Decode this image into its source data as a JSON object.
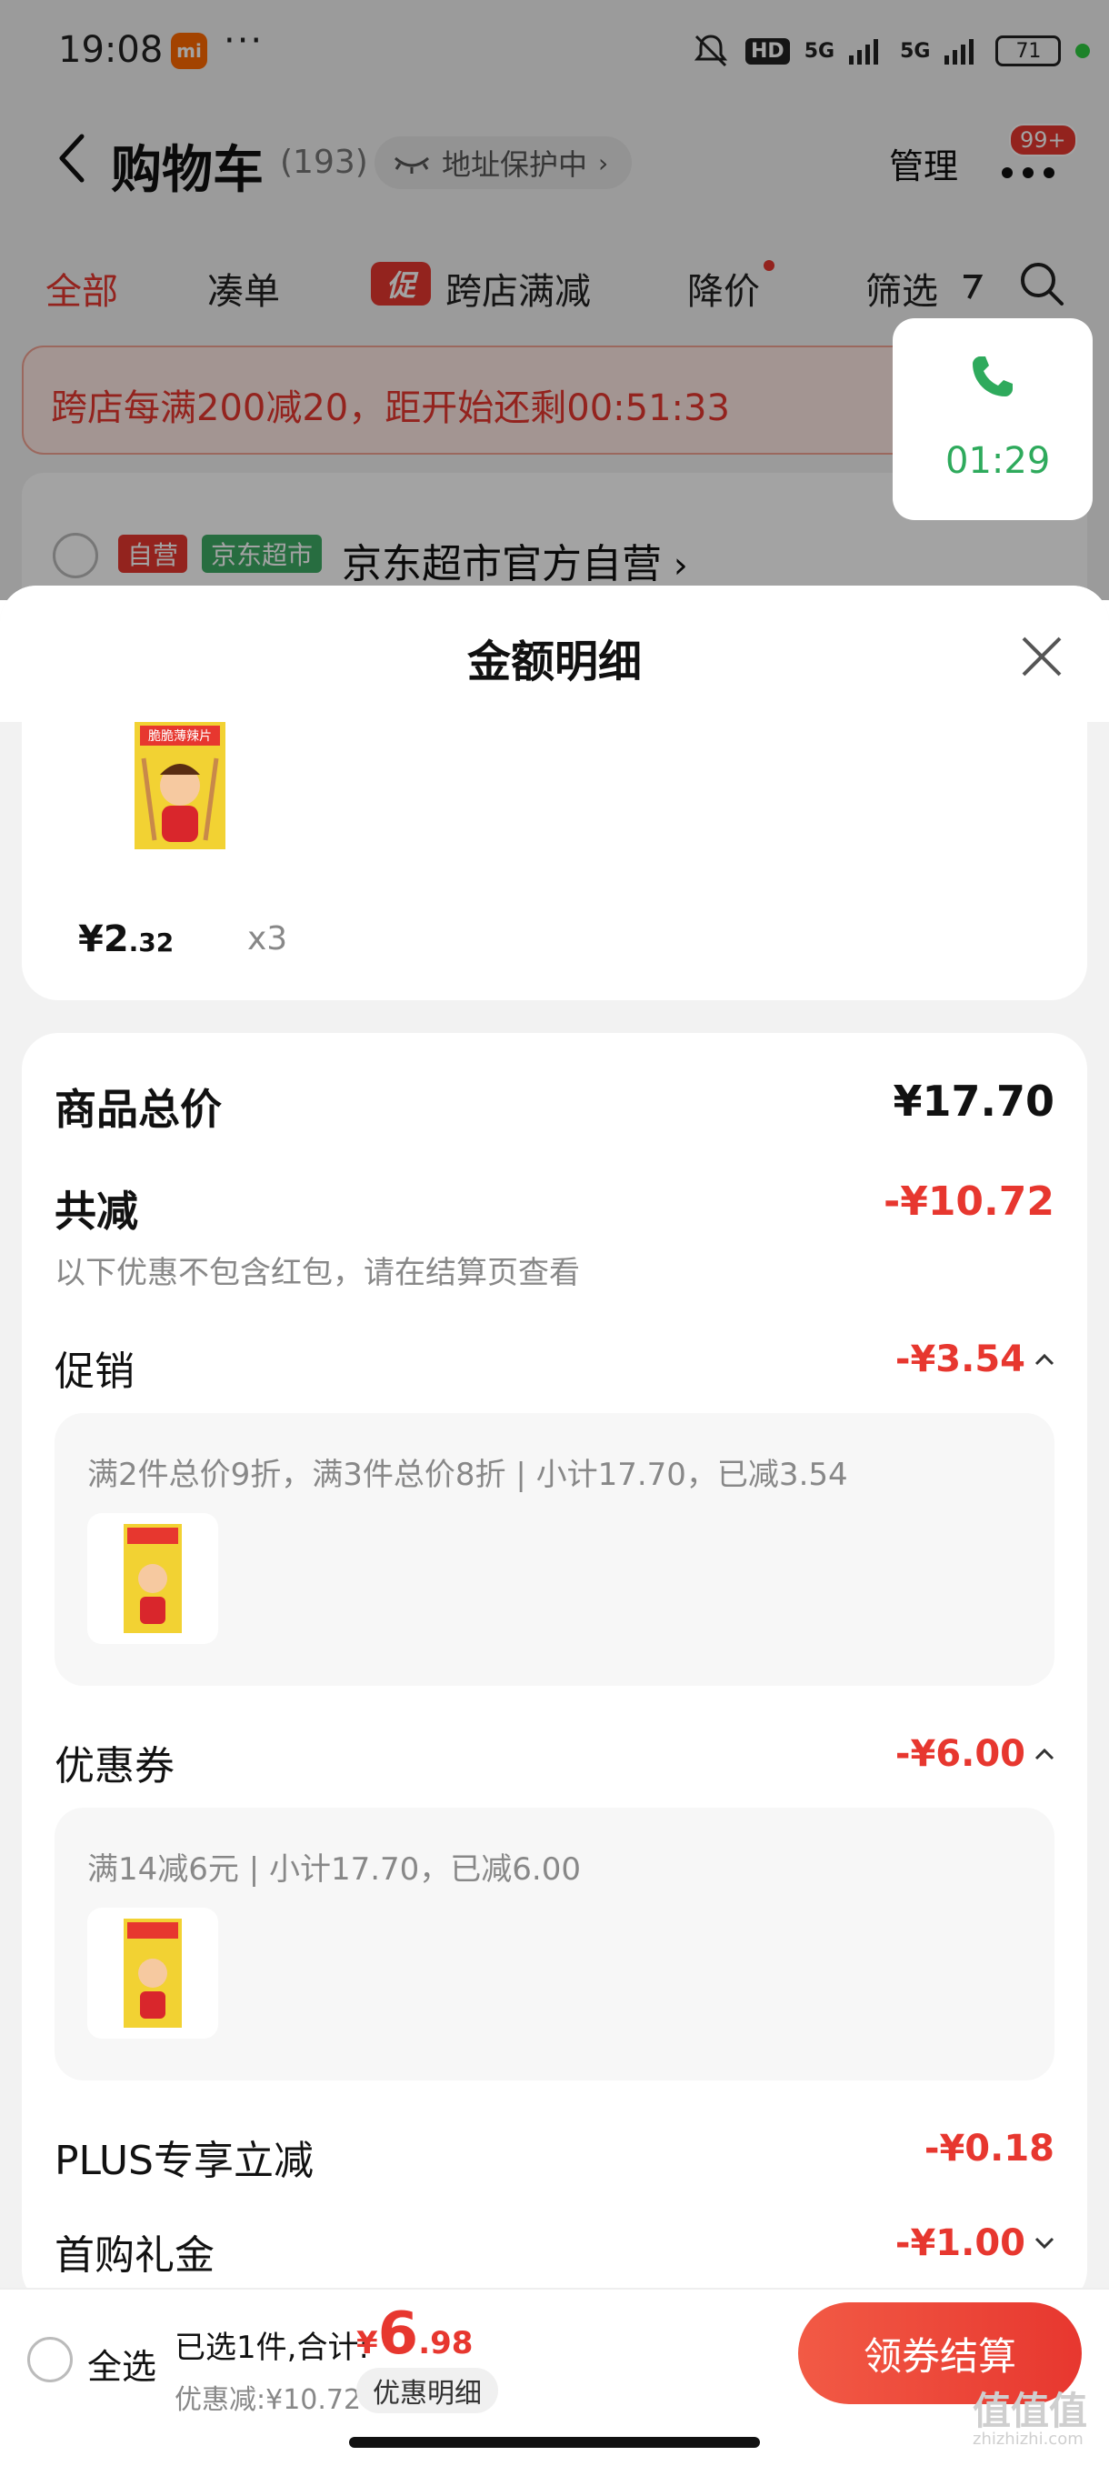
{
  "status_bar": {
    "time": "19:08",
    "app_icon": "mi",
    "dots": "···",
    "hd_label": "HD",
    "net1": "5G",
    "net2": "5G",
    "battery": "71"
  },
  "header": {
    "title": "购物车",
    "count": "(193)",
    "address_protect": "地址保护中",
    "manage": "管理",
    "badge": "99+"
  },
  "tabs": [
    {
      "label": "全部",
      "active": true
    },
    {
      "label": "凑单"
    },
    {
      "label": "跨店满减",
      "badge": "促"
    },
    {
      "label": "降价"
    },
    {
      "label": "筛选"
    }
  ],
  "promo_bar": {
    "text": "跨店每满200减20，距开始还剩00:51:33"
  },
  "call": {
    "time": "01:29"
  },
  "store": {
    "tag1": "自营",
    "tag2": "京东超市",
    "name": "京东超市官方自营"
  },
  "sheet": {
    "title": "金额明细",
    "product": {
      "price_int": "¥2",
      "price_dec": ".32",
      "qty": "x3",
      "image_label": "脆脆薄辣片"
    },
    "rows": {
      "total_label": "商品总价",
      "total_value": "¥17.70",
      "reduce_label": "共减",
      "reduce_value": "-¥10.72",
      "reduce_note": "以下优惠不包含红包，请在结算页查看",
      "promo_label": "促销",
      "promo_value": "-¥3.54",
      "promo_detail": "满2件总价9折，满3件总价8折 | 小计17.70，已减3.54",
      "coupon_label": "优惠券",
      "coupon_value": "-¥6.00",
      "coupon_detail": "满14减6元 | 小计17.70，已减6.00",
      "plus_label": "PLUS专享立减",
      "plus_value": "-¥0.18",
      "first_label": "首购礼金",
      "first_value": "-¥1.00"
    }
  },
  "bottom": {
    "select_all": "全选",
    "selected": "已选1件,合计:",
    "currency": "¥",
    "total_int": "6",
    "total_dec": ".98",
    "discount": "优惠减:¥10.72",
    "detail": "优惠明细",
    "checkout": "领券结算",
    "watermark": "值值值",
    "watermark_url": "zhizhizhi.com"
  },
  "colors": {
    "accent": "#e7372f",
    "green": "#3eab65",
    "call_green": "#2eaa5c"
  }
}
